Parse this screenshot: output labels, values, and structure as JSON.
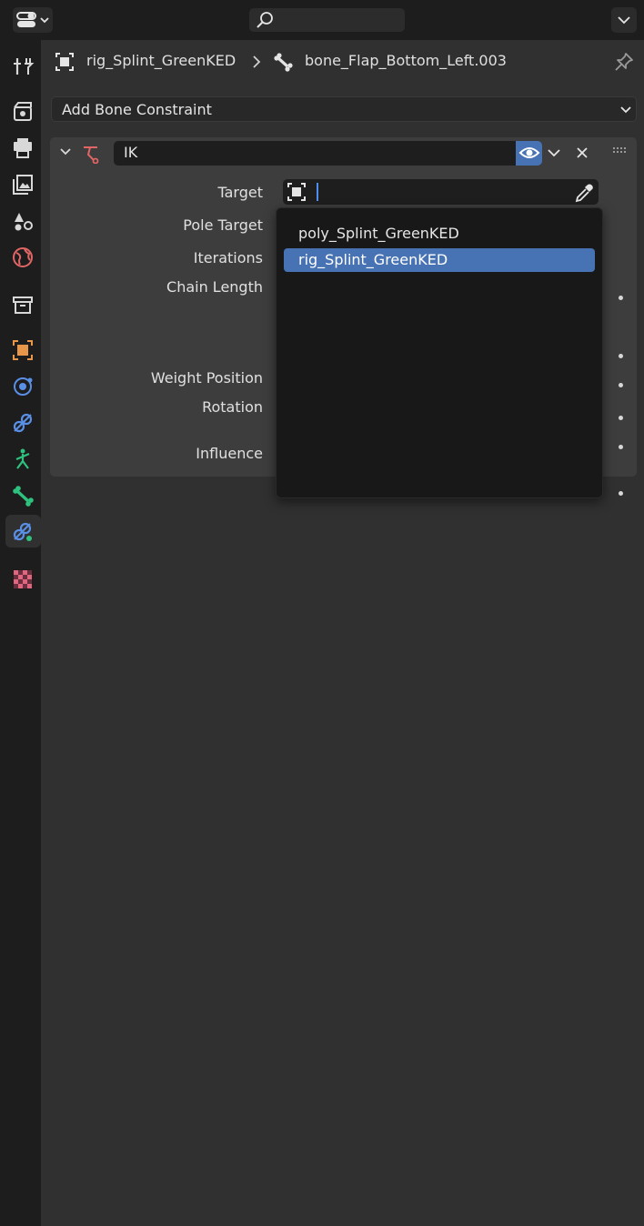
{
  "header": {
    "editor_type_icon": "properties-editor-icon",
    "search_icon": "search-icon",
    "menu_icon": "chevron-down-icon"
  },
  "tabs": [
    {
      "name": "tool",
      "icon": "tool-icon"
    },
    {
      "name": "render",
      "icon": "render-icon"
    },
    {
      "name": "output",
      "icon": "output-icon"
    },
    {
      "name": "view-layer",
      "icon": "view-layer-icon"
    },
    {
      "name": "scene",
      "icon": "scene-icon"
    },
    {
      "name": "world",
      "icon": "world-icon"
    },
    {
      "name": "collection",
      "icon": "collection-icon"
    },
    {
      "name": "object",
      "icon": "object-icon"
    },
    {
      "name": "physics",
      "icon": "physics-icon"
    },
    {
      "name": "object-constraints",
      "icon": "object-constraint-icon"
    },
    {
      "name": "object-data",
      "icon": "armature-data-icon"
    },
    {
      "name": "bone",
      "icon": "bone-icon"
    },
    {
      "name": "bone-constraints",
      "icon": "bone-constraint-icon",
      "active": true
    },
    {
      "name": "texture",
      "icon": "texture-icon"
    }
  ],
  "breadcrumb": {
    "object_name": "rig_Splint_GreenKED",
    "separator": ">",
    "bone_name": "bone_Flap_Bottom_Left.003"
  },
  "add_constraint": {
    "label": "Add Bone Constraint"
  },
  "constraint": {
    "name": "IK",
    "properties": {
      "target": "Target",
      "pole_target": "Pole Target",
      "iterations": "Iterations",
      "chain_length": "Chain Length",
      "weight_position": "Weight Position",
      "rotation": "Rotation",
      "influence": "Influence"
    },
    "target_value": ""
  },
  "target_dropdown": {
    "items": [
      {
        "label": "poly_Splint_GreenKED",
        "selected": false
      },
      {
        "label": "rig_Splint_GreenKED",
        "selected": true
      }
    ]
  },
  "colors": {
    "accent": "#4772b3",
    "constraint_icon": "#e06666",
    "bone_icon": "#2ec27e"
  }
}
